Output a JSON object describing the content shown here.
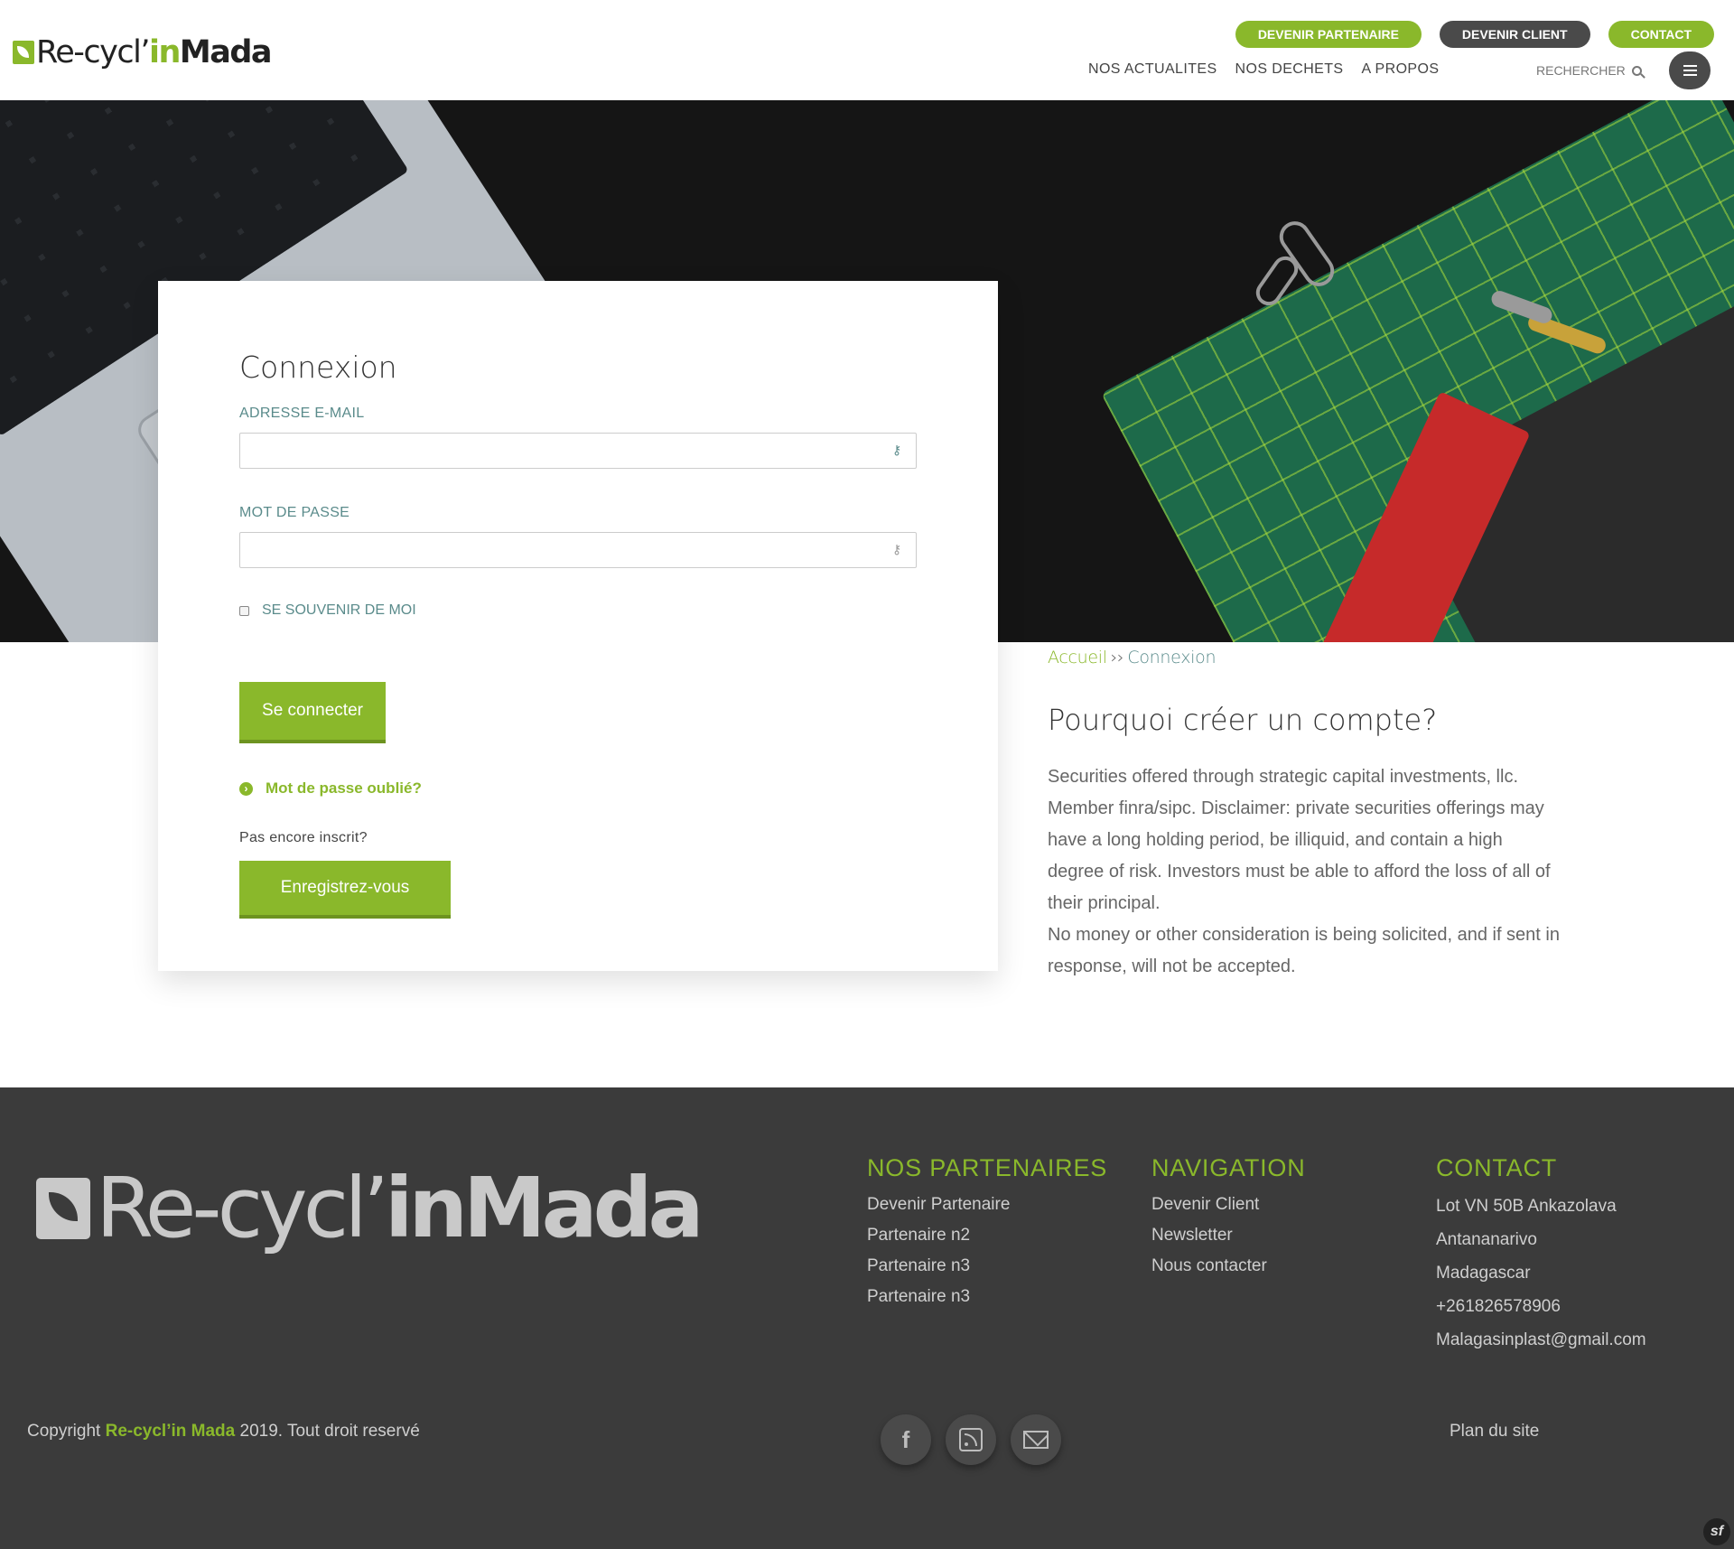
{
  "header": {
    "logo": {
      "part1": "Re-cycl’",
      "part2": "in",
      "part3": "Mada"
    },
    "top_buttons": {
      "partner": "DEVENIR PARTENAIRE",
      "client": "DEVENIR CLIENT",
      "contact": "CONTACT"
    },
    "nav": [
      "NOS ACTUALITES",
      "NOS DECHETS",
      "A PROPOS"
    ],
    "search_label": "RECHERCHER"
  },
  "login": {
    "title": "Connexion",
    "email_label": "ADRESSE E-MAIL",
    "email_value": "",
    "password_label": "MOT DE PASSE",
    "password_value": "",
    "remember_label": "SE SOUVENIR DE MOI",
    "submit_label": "Se connecter",
    "forgot_label": "Mot de passe oublié?",
    "not_registered": "Pas encore inscrit?",
    "register_label": "Enregistrez-vous"
  },
  "breadcrumb": {
    "home": "Accueil",
    "separator": "››",
    "current": "Connexion"
  },
  "why": {
    "title": "Pourquoi créer un compte?",
    "text": "Securities offered through strategic capital investments, llc. Member finra/sipc. Disclaimer: private securities offerings may have a long holding period, be illiquid, and contain a high degree of risk. Investors must be able to afford the loss of all of their principal.",
    "text2": "No money or other consideration is being solicited, and if sent in response, will not be accepted."
  },
  "footer": {
    "logo": {
      "part1": "Re-cycl’",
      "part2": "in",
      "part3": "Mada"
    },
    "partners": {
      "title": "NOS PARTENAIRES",
      "items": [
        "Devenir Partenaire",
        "Partenaire n2",
        "Partenaire n3",
        "Partenaire n3"
      ]
    },
    "navigation": {
      "title": "NAVIGATION",
      "items": [
        "Devenir Client",
        "Newsletter",
        "Nous contacter"
      ]
    },
    "contact": {
      "title": "CONTACT",
      "items": [
        "Lot VN 50B Ankazolava",
        "Antananarivo",
        "Madagascar",
        "+261826578906",
        "Malagasinplast@gmail.com"
      ]
    },
    "copyright": {
      "prefix": "Copyright",
      "brand": "Re-cycl’in Mada",
      "suffix": "2019. Tout droit reservé"
    },
    "socials": [
      "facebook-icon",
      "rss-icon",
      "mail-icon"
    ],
    "facebook_glyph": "f",
    "plan_label": "Plan du site",
    "symfony_glyph": "sf"
  },
  "colors": {
    "accent": "#8ab82b",
    "dark_button": "#4a4a4a",
    "footer_bg": "#3b3b3b",
    "label_teal": "#5a8b8b"
  }
}
